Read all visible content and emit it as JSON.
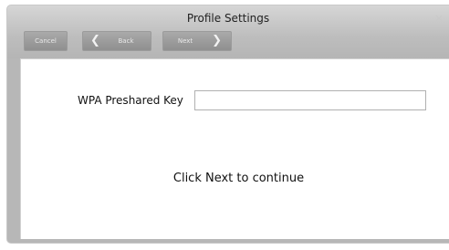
{
  "window": {
    "title": "Profile Settings",
    "close_glyph": "✕"
  },
  "toolbar": {
    "cancel_label": "Cancel",
    "back_label": "Back",
    "next_label": "Next"
  },
  "form": {
    "wpa_key_label": "WPA Preshared Key",
    "wpa_key_value": "",
    "wpa_key_placeholder": ""
  },
  "hint_text": "Click Next to continue",
  "icons": {
    "back": "chevron-left-icon",
    "next": "chevron-right-icon",
    "close": "close-icon"
  }
}
